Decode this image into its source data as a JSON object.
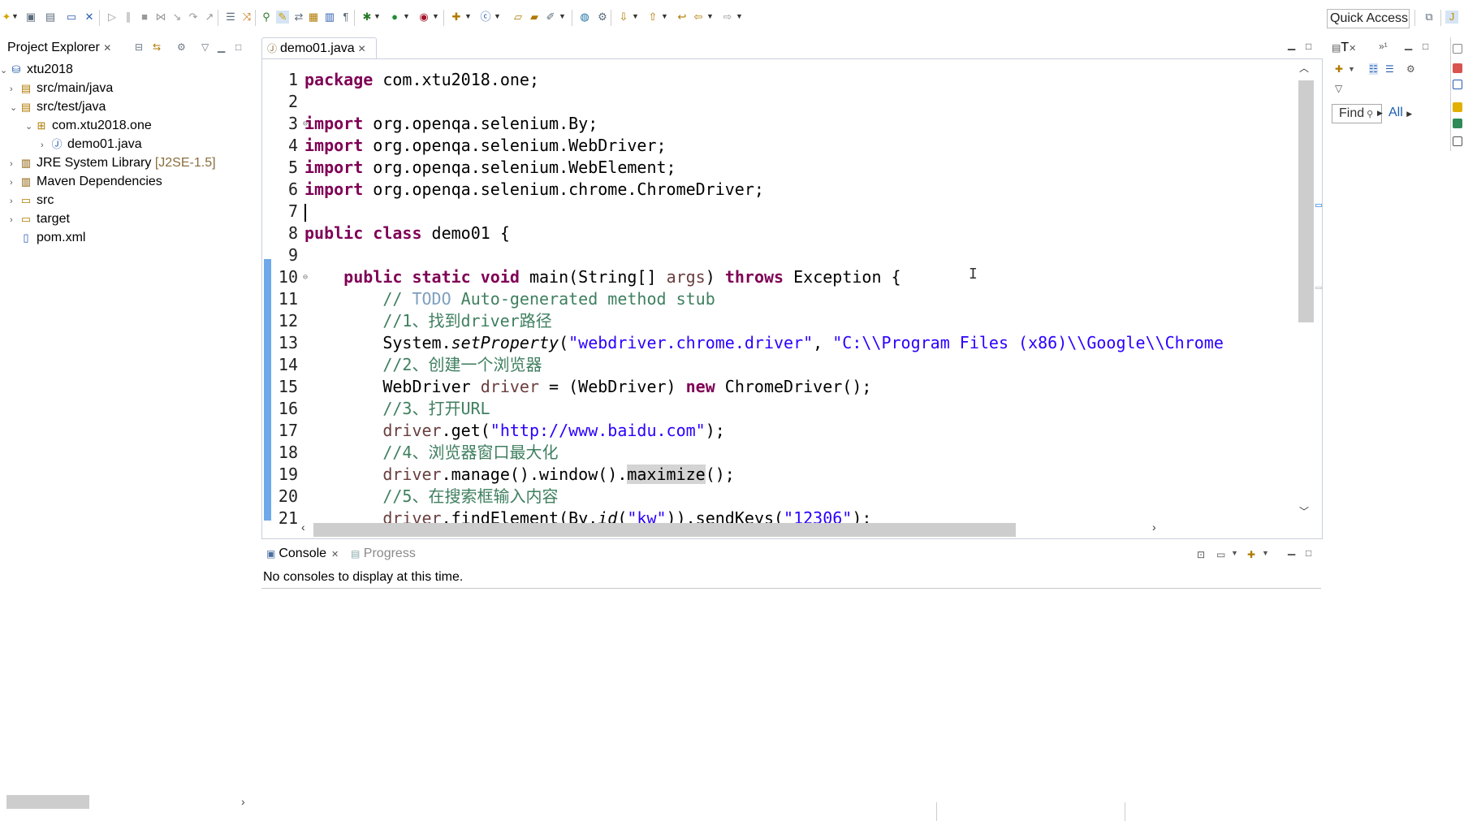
{
  "toolbar": {
    "quick_access": "Quick Access"
  },
  "project_explorer": {
    "title": "Project Explorer",
    "items": [
      {
        "label": "xtu2018",
        "decoration": ""
      },
      {
        "label": "src/main/java",
        "decoration": ""
      },
      {
        "label": "src/test/java",
        "decoration": ""
      },
      {
        "label": "com.xtu2018.one",
        "decoration": ""
      },
      {
        "label": "demo01.java",
        "decoration": ""
      },
      {
        "label": "JRE System Library",
        "decoration": "[J2SE-1.5]"
      },
      {
        "label": "Maven Dependencies",
        "decoration": ""
      },
      {
        "label": "src",
        "decoration": ""
      },
      {
        "label": "target",
        "decoration": ""
      },
      {
        "label": "pom.xml",
        "decoration": ""
      }
    ]
  },
  "editor": {
    "tab_label": "demo01.java",
    "line_numbers": [
      "1",
      "2",
      "3",
      "4",
      "5",
      "6",
      "7",
      "8",
      "9",
      "10",
      "11",
      "12",
      "13",
      "14",
      "15",
      "16",
      "17",
      "18",
      "19",
      "20",
      "21"
    ]
  },
  "code": {
    "l1": [
      "package",
      " com.xtu2018.one;"
    ],
    "l3": [
      "import",
      " org.openqa.selenium.By;"
    ],
    "l4": [
      "import",
      " org.openqa.selenium.WebDriver;"
    ],
    "l5": [
      "import",
      " org.openqa.selenium.WebElement;"
    ],
    "l6": [
      "import",
      " org.openqa.selenium.chrome.ChromeDriver;"
    ],
    "l8": [
      "public",
      " ",
      "class",
      " demo01 {"
    ],
    "l10": [
      "    ",
      "public",
      " ",
      "static",
      " ",
      "void",
      " main(String[] ",
      "args",
      ") ",
      "throws",
      " Exception {"
    ],
    "l11": [
      "        // ",
      "TODO",
      " Auto-generated method stub"
    ],
    "l12": "        //1、找到driver路径",
    "l13": [
      "        System.",
      "setProperty",
      "(",
      "\"webdriver.chrome.driver\"",
      ", ",
      "\"C:\\\\Program Files (x86)\\\\Google\\\\Chrome"
    ],
    "l14": "        //2、创建一个浏览器",
    "l15": [
      "        WebDriver ",
      "driver",
      " = (WebDriver) ",
      "new",
      " ChromeDriver();"
    ],
    "l16": "        //3、打开URL",
    "l17": [
      "        ",
      "driver",
      ".get(",
      "\"http://www.baidu.com\"",
      ");"
    ],
    "l18": "        //4、浏览器窗口最大化",
    "l19": [
      "        ",
      "driver",
      ".manage().window().",
      "maximize",
      "();"
    ],
    "l20": "        //5、在搜索框输入内容",
    "l21": [
      "        ",
      "driver",
      ".findElement(By.",
      "id",
      "(",
      "\"kw\"",
      ")).sendKeys(",
      "\"12306\"",
      ");"
    ]
  },
  "console": {
    "tab_label": "Console",
    "progress_label": "Progress",
    "message": "No consoles to display at this time."
  },
  "outline": {
    "tab_label": "T",
    "find_label": "Find",
    "all_label": "All"
  }
}
